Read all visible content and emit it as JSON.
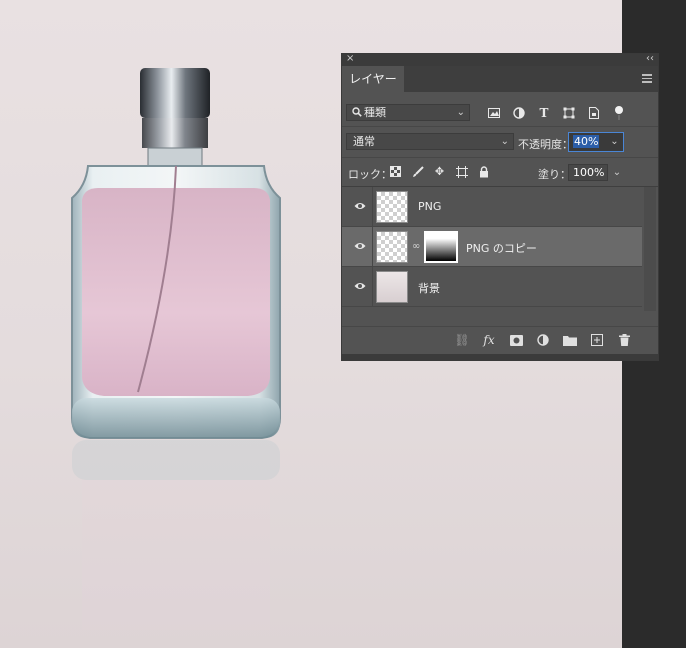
{
  "panel": {
    "close_glyph": "×",
    "collapse_glyph": "‹‹",
    "tab_label": "レイヤー",
    "filter": {
      "value": "種類",
      "icon": "search-icon"
    },
    "filter_icons": [
      "image-filter-icon",
      "adjustment-filter-icon",
      "type-filter-icon",
      "shape-filter-icon",
      "smart-object-filter-icon",
      "filter-toggle-icon"
    ],
    "blend_mode": "通常",
    "opacity_label": "不透明度：",
    "opacity_value": "40%",
    "lock_label": "ロック：",
    "lock_icons": [
      "lock-transparent-pixels-icon",
      "lock-image-pixels-icon",
      "lock-position-icon",
      "lock-artboard-icon",
      "lock-all-icon"
    ],
    "fill_label": "塗り：",
    "fill_value": "100%",
    "layers": [
      {
        "name": "PNG",
        "visible": true,
        "selected": false
      },
      {
        "name": "PNG のコピー",
        "visible": true,
        "selected": true,
        "has_mask": true
      },
      {
        "name": "背景",
        "visible": true,
        "selected": false
      }
    ],
    "footer_icons": [
      "link-layers-icon",
      "fx-icon",
      "add-mask-icon",
      "adjustment-layer-icon",
      "new-group-icon",
      "new-layer-icon",
      "delete-layer-icon"
    ],
    "fx_glyph": "fx"
  },
  "colors": {
    "canvas_bg": "#e6dedf",
    "panel_bg": "#535353",
    "selected_row": "#6a6a6a",
    "highlight_box": "#d9232b",
    "input_focus": "#4a86d6"
  }
}
